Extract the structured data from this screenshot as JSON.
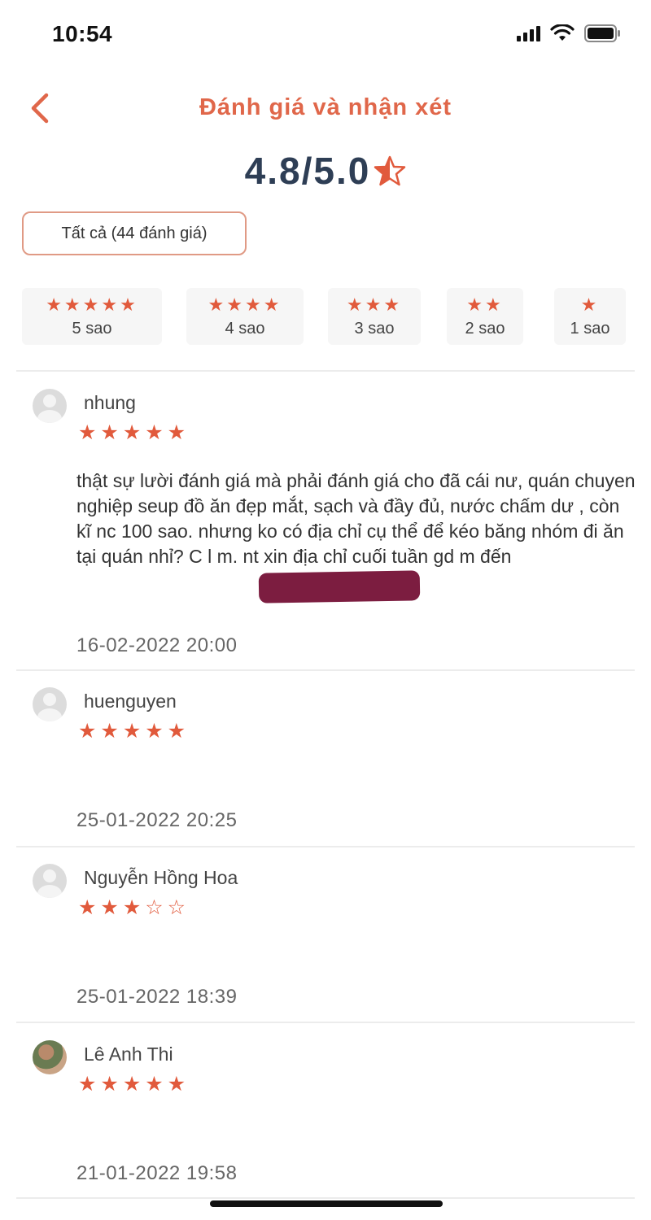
{
  "status_bar": {
    "time": "10:54"
  },
  "header": {
    "title": "Đánh giá và nhận xét"
  },
  "rating": {
    "value": "4.8/5.0"
  },
  "filter_all": {
    "label": "Tất cả (44 đánh giá)"
  },
  "star_filters": [
    {
      "stars": "★★★★★",
      "label": "5 sao"
    },
    {
      "stars": "★★★★",
      "label": "4 sao"
    },
    {
      "stars": "★★★",
      "label": "3 sao"
    },
    {
      "stars": "★★",
      "label": "2 sao"
    },
    {
      "stars": "★",
      "label": "1 sao"
    }
  ],
  "reviews": [
    {
      "name": "nhung",
      "stars": "★★★★★",
      "text": "thật sự lười đánh giá mà phải đánh giá cho đã cái nư, quán chuyen nghiệp seup đồ ăn đẹp mắt, sạch và đầy đủ, nước chấm dư , còn kĩ nc 100 sao. nhưng ko có địa chỉ cụ thể để kéo băng nhóm đi ăn tại quán nhỉ? C                   l m. nt xin địa chỉ cuối tuần gd m đến",
      "date": "16-02-2022 20:00"
    },
    {
      "name": "huenguyen",
      "stars": "★★★★★",
      "text": "",
      "date": "25-01-2022 20:25"
    },
    {
      "name": "Nguyễn Hồng Hoa",
      "stars": "★★★☆☆",
      "text": "",
      "date": "25-01-2022 18:39"
    },
    {
      "name": "Lê Anh Thi",
      "stars": "★★★★★",
      "text": "",
      "date": "21-01-2022 19:58"
    }
  ],
  "colors": {
    "accent": "#e0674a",
    "star": "#e15a3c",
    "rating_text": "#2e3e55",
    "redaction": "#7c1d40"
  }
}
